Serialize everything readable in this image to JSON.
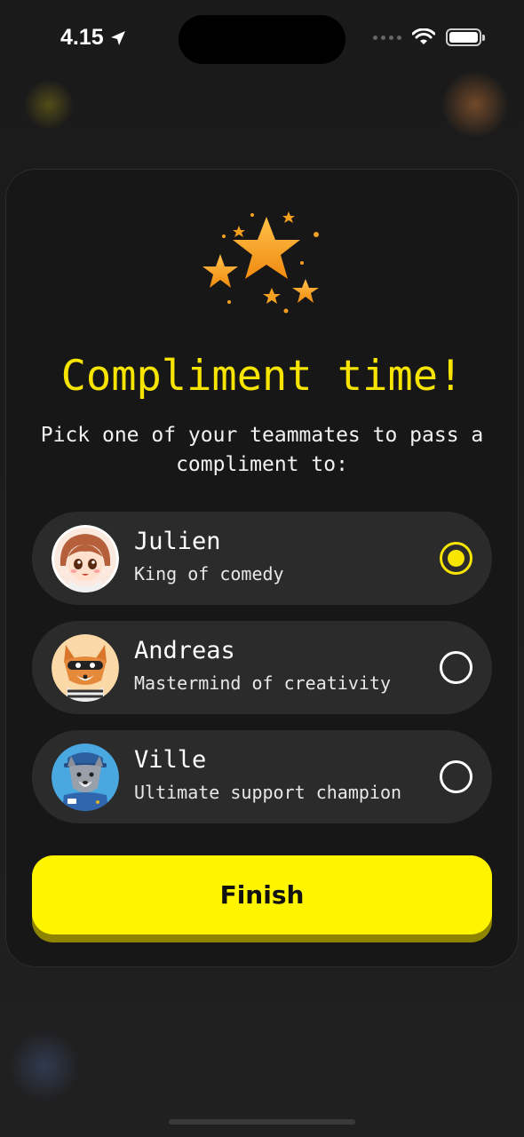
{
  "status_bar": {
    "time": "4.15",
    "location_icon": "location-arrow-icon",
    "wifi_icon": "wifi-icon",
    "battery_icon": "battery-icon"
  },
  "dialog": {
    "icon": "stars-icon",
    "title": "Compliment time!",
    "subtitle": "Pick one of your teammates to pass a compliment to:",
    "options": [
      {
        "name": "Julien",
        "description": "King of comedy",
        "selected": true,
        "avatar": "girl-avatar"
      },
      {
        "name": "Andreas",
        "description": "Mastermind of creativity",
        "selected": false,
        "avatar": "fox-avatar"
      },
      {
        "name": "Ville",
        "description": "Ultimate support champion",
        "selected": false,
        "avatar": "wolf-avatar"
      }
    ],
    "finish_label": "Finish"
  },
  "colors": {
    "accent_yellow": "#f7e400",
    "button_yellow": "#fff500",
    "card_bg": "#171717",
    "option_bg": "#2b2b2b"
  }
}
